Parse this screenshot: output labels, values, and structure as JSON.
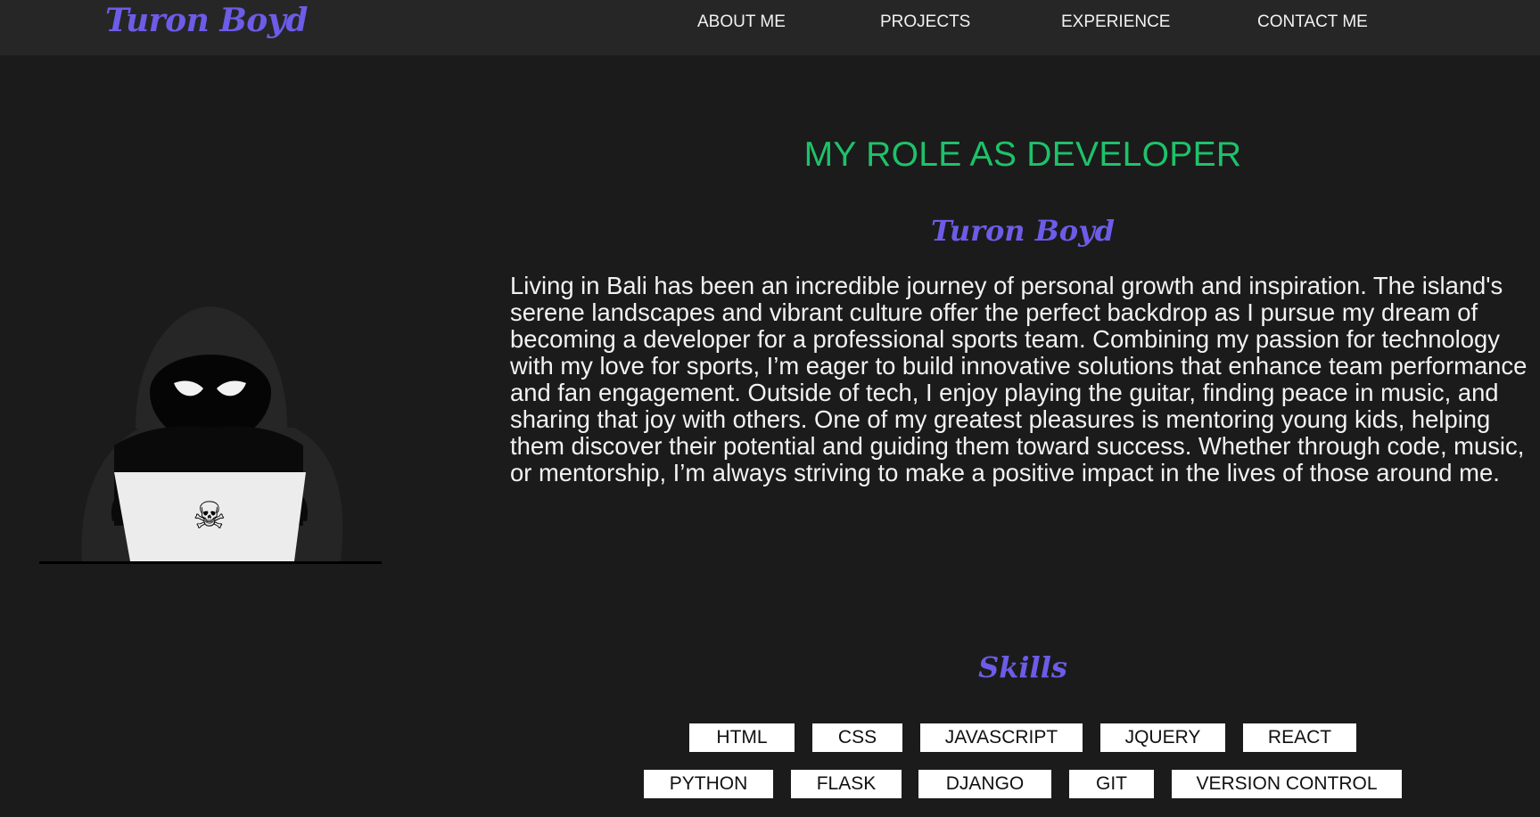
{
  "navbar": {
    "brand": "Turon Boyd",
    "links": [
      "ABOUT ME",
      "PROJECTS",
      "EXPERIENCE",
      "CONTACT ME"
    ]
  },
  "about": {
    "role_title": "MY ROLE AS DEVELOPER",
    "name": "Turon Boyd",
    "bio": "Living in Bali has been an incredible journey of personal growth and inspiration. The island's serene landscapes and vibrant culture offer the perfect backdrop as I pursue my dream of becoming a developer for a professional sports team. Combining my passion for technology with my love for sports, I’m eager to build innovative solutions that enhance team performance and fan engagement. Outside of tech, I enjoy playing the guitar, finding peace in music, and sharing that joy with others. One of my greatest pleasures is mentoring young kids, helping them discover their potential and guiding them toward success. Whether through code, music, or mentorship, I’m always striving to make a positive impact in the lives of those around me."
  },
  "skills": {
    "title": "Skills",
    "items": [
      "HTML",
      "CSS",
      "JAVASCRIPT",
      "JQUERY",
      "REACT",
      "PYTHON",
      "FLASK",
      "DJANGO",
      "GIT",
      "VERSION CONTROL"
    ]
  },
  "colors": {
    "background": "#1b1b1b",
    "navbar": "#262626",
    "accent_purple": "#6c5ce7",
    "accent_green": "#1ec26a",
    "text": "#f2f2f2"
  },
  "icons": {
    "illustration": "hooded-hacker-illustration",
    "laptop_emblem": "skull-crossbones-icon"
  }
}
